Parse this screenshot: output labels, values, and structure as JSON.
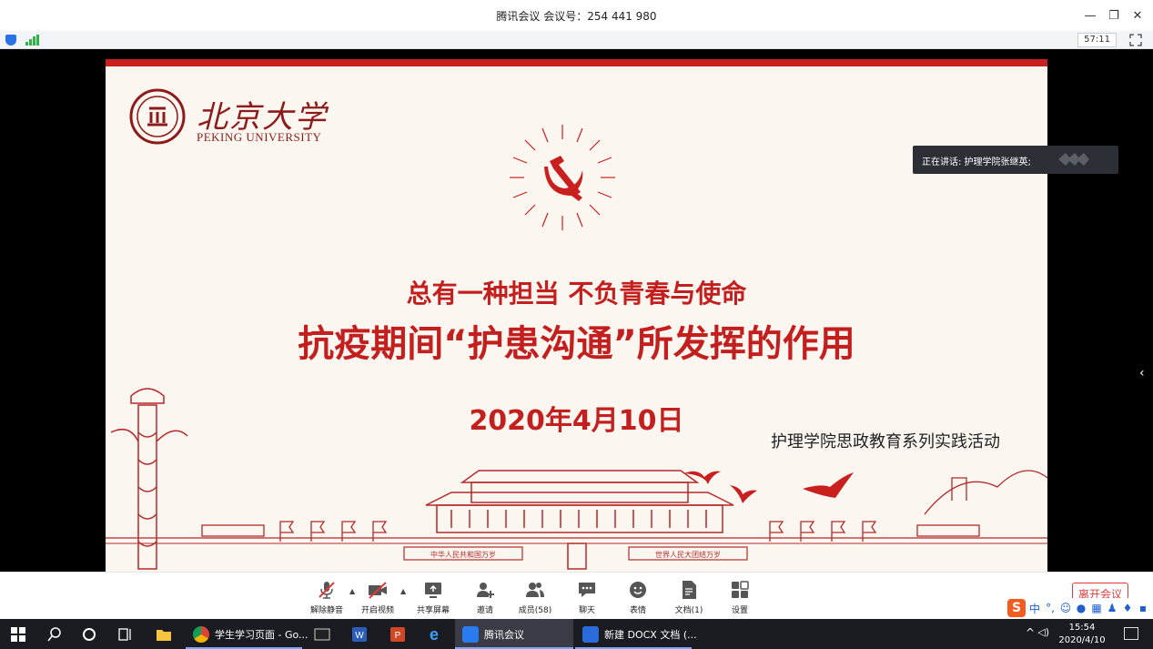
{
  "window": {
    "title": "腾讯会议 会议号：254 441 980",
    "controls": {
      "minimize": "—",
      "restore": "❐",
      "close": "✕"
    }
  },
  "statusbar": {
    "timer": "57:11"
  },
  "slide": {
    "university_cn": "北京大学",
    "university_en": "PEKING UNIVERSITY",
    "subtitle": "总有一种担当   不负青春与使命",
    "title": "抗疫期间“护患沟通”所发挥的作用",
    "date": "2020年4月10日",
    "organizer": "护理学院思政教育系列实践活动",
    "banner_left": "中华人民共和国万岁",
    "banner_right": "世界人民大团结万岁"
  },
  "speaker": {
    "text": "正在讲话: 护理学院张继英;"
  },
  "toolbar": {
    "unmute": "解除静音",
    "start_video": "开启视频",
    "share_screen": "共享屏幕",
    "invite": "邀请",
    "members": "成员(58)",
    "chat": "聊天",
    "reactions": "表情",
    "docs": "文档(1)",
    "settings": "设置",
    "leave": "离开会议"
  },
  "ime": {
    "lang": "中",
    "punct": "°,"
  },
  "taskbar": {
    "apps": [
      {
        "label": "学生学习页面 - Go..."
      },
      {
        "label": "腾讯会议"
      },
      {
        "label": "新建 DOCX 文档 (..."
      }
    ],
    "time": "15:54",
    "date": "2020/4/10"
  },
  "colors": {
    "slide_red": "#c41f1f",
    "leave_red": "#e03a3a",
    "taskbar_bg": "#1b1c22"
  }
}
